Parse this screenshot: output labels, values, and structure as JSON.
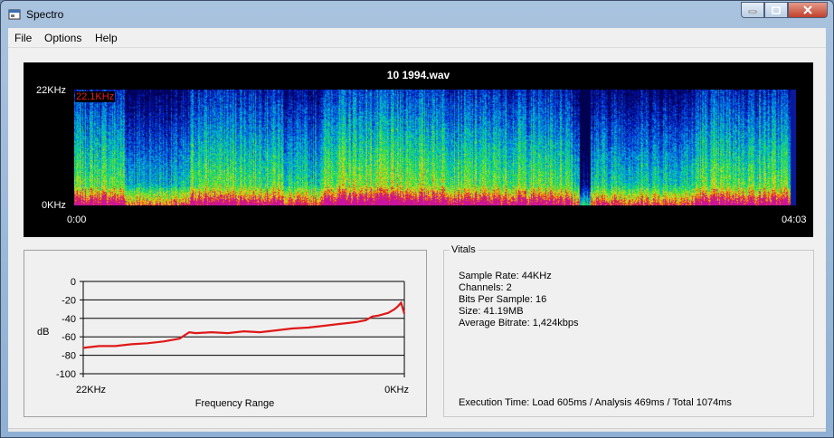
{
  "window": {
    "title": "Spectro"
  },
  "menu": {
    "items": [
      "File",
      "Options",
      "Help"
    ]
  },
  "spectrogram": {
    "file_title": "10 1994.wav",
    "y_top_label": "22KHz",
    "y_bottom_label": "0KHz",
    "x_start_label": "0:00",
    "x_end_label": "04:03",
    "cutoff_label": "22.1KHz"
  },
  "chart_data": {
    "type": "line",
    "title": "",
    "xlabel": "Frequency Range",
    "ylabel": "dB",
    "x_tick_labels": [
      "22KHz",
      "0KHz"
    ],
    "y_ticks": [
      0,
      -20,
      -40,
      -60,
      -80,
      -100
    ],
    "ylim": [
      -100,
      0
    ],
    "grid": "horizontal",
    "series": [
      {
        "color": "#e01818",
        "x_norm": [
          0,
          0.05,
          0.1,
          0.15,
          0.2,
          0.25,
          0.3,
          0.33,
          0.35,
          0.4,
          0.45,
          0.5,
          0.55,
          0.6,
          0.65,
          0.7,
          0.75,
          0.8,
          0.85,
          0.88,
          0.9,
          0.92,
          0.95,
          0.97,
          0.98,
          0.99,
          1.0
        ],
        "values": [
          -72,
          -70,
          -70,
          -68,
          -67,
          -65,
          -62,
          -55,
          -56,
          -55,
          -56,
          -54,
          -55,
          -53,
          -51,
          -50,
          -48,
          -46,
          -44,
          -42,
          -38,
          -37,
          -34,
          -30,
          -27,
          -23,
          -35
        ]
      }
    ]
  },
  "vitals": {
    "legend": "Vitals",
    "lines": [
      "Sample Rate: 44KHz",
      "Channels: 2",
      "Bits Per Sample: 16",
      "Size: 41.19MB",
      "Average Bitrate: 1,424kbps"
    ],
    "execution": "Execution Time: Load 605ms / Analysis 469ms / Total 1074ms"
  }
}
